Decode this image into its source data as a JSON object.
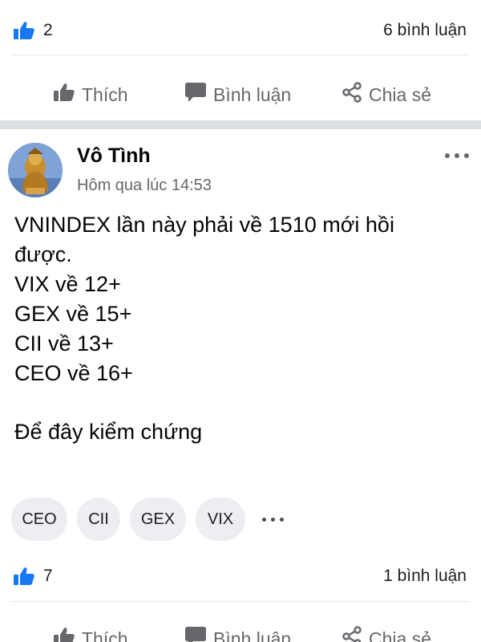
{
  "top_post": {
    "like_count": "2",
    "comment_count": "6 bình luận"
  },
  "actions": {
    "like": "Thích",
    "comment": "Bình luận",
    "share": "Chia sẻ"
  },
  "post": {
    "author": "Vô Tình",
    "timestamp": "Hôm qua lúc 14:53",
    "body_lines": [
      "VNINDEX lần này phải về 1510 mới hồi",
      "được.",
      "VIX về 12+",
      "GEX về 15+",
      "CII về 13+",
      "CEO về 16+",
      "",
      "Để đây kiểm chứng"
    ],
    "tags": [
      "CEO",
      "CII",
      "GEX",
      "VIX"
    ],
    "like_count": "7",
    "comment_count": "1 bình luận"
  },
  "colors": {
    "like_blue": "#1877f2",
    "secondary_text": "#65676b",
    "tag_bg": "#eceef1"
  },
  "icons": {
    "like_badge": "thumbs-up-icon",
    "like_action": "thumbs-up-outline-icon",
    "comment_action": "speech-bubble-icon",
    "share_action": "share-icon",
    "more": "more-horizontal-icon"
  }
}
